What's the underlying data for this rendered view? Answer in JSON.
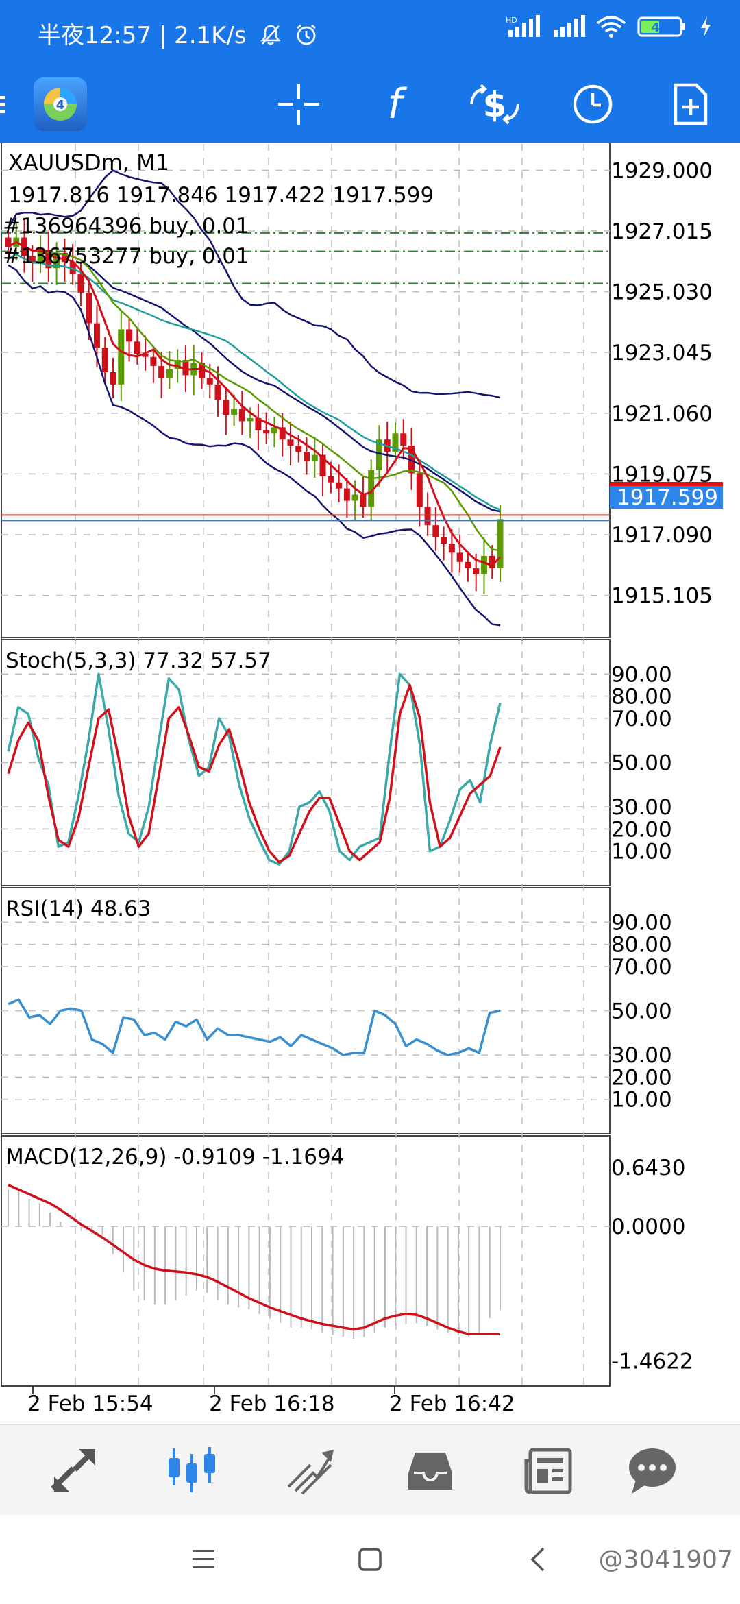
{
  "status": {
    "time": "半夜12:57",
    "speed": "2.1K/s",
    "battery": "41",
    "hd_label": "HD"
  },
  "toolbar": {
    "icons": [
      "menu-icon",
      "metatrader-logo-icon",
      "crosshair-icon",
      "indicators-icon",
      "trade-icon",
      "timeframe-icon",
      "templates-icon"
    ]
  },
  "chart": {
    "symbol": "XAUUSDm, M1",
    "ohlc": "1917.816 1917.846 1917.422 1917.599",
    "orders": [
      "#136964396 buy, 0.01",
      "#136753277 buy, 0.01"
    ],
    "current_price": "1917.599",
    "colors": {
      "bull": "#5c9b00",
      "bear": "#d0101a",
      "bollinger": "#141472",
      "ma_slow": "#1f9e9e",
      "ma_fast": "#5c9b00",
      "ma_red": "#d0101a",
      "bid_line": "#c0392b",
      "ask_line": "#3a78c2",
      "price_label_bg": "#2e86e8"
    }
  },
  "chart_data": [
    {
      "type": "candlestick",
      "title": "XAUUSDm, M1",
      "ylim": [
        1914.0,
        1929.5
      ],
      "y_ticks": [
        "1929.000",
        "1927.015",
        "1925.030",
        "1923.045",
        "1921.060",
        "1919.075",
        "1917.090",
        "1915.105"
      ],
      "x_ticks": [
        "2 Feb 15:54",
        "2 Feb 16:18",
        "2 Feb 16:42"
      ],
      "candles_close": [
        1926.5,
        1926.8,
        1926.2,
        1926.0,
        1926.4,
        1925.8,
        1926.3,
        1926.0,
        1925.6,
        1925.0,
        1924.0,
        1923.2,
        1922.4,
        1922.0,
        1923.8,
        1923.4,
        1923.0,
        1922.9,
        1922.6,
        1922.2,
        1922.5,
        1922.8,
        1922.3,
        1922.7,
        1922.2,
        1922.0,
        1921.5,
        1921.0,
        1921.2,
        1920.8,
        1920.9,
        1920.5,
        1920.4,
        1920.6,
        1920.2,
        1920.0,
        1919.8,
        1919.5,
        1919.7,
        1919.0,
        1918.8,
        1918.6,
        1918.2,
        1918.4,
        1918.0,
        1919.2,
        1920.2,
        1919.8,
        1920.4,
        1920.0,
        1919.1,
        1918.0,
        1917.4,
        1917.0,
        1916.8,
        1916.5,
        1916.2,
        1916.0,
        1915.8,
        1916.4,
        1916.0,
        1917.6
      ],
      "current": 1917.599,
      "series": [
        {
          "name": "",
          "values": []
        }
      ]
    },
    {
      "type": "line",
      "title": "Stoch(5,3,3) 77.32 57.57",
      "ylim": [
        0,
        100
      ],
      "y_ticks": [
        "90.00",
        "80.00",
        "70.00",
        "50.00",
        "30.00",
        "20.00",
        "10.00"
      ],
      "series": [
        {
          "name": "",
          "values": [
            55,
            75,
            72,
            52,
            40,
            12,
            14,
            35,
            60,
            90,
            65,
            35,
            18,
            14,
            30,
            60,
            88,
            83,
            60,
            44,
            48,
            70,
            62,
            40,
            25,
            15,
            6,
            4,
            10,
            30,
            32,
            37,
            28,
            10,
            6,
            12,
            14,
            16,
            55,
            90,
            85,
            58,
            10,
            12,
            24,
            38,
            42,
            32,
            58,
            77
          ]
        },
        {
          "name": "",
          "values": [
            45,
            60,
            68,
            60,
            35,
            15,
            12,
            25,
            48,
            70,
            74,
            52,
            26,
            12,
            18,
            44,
            70,
            75,
            62,
            48,
            46,
            58,
            65,
            50,
            32,
            20,
            10,
            5,
            8,
            18,
            28,
            34,
            34,
            22,
            10,
            6,
            10,
            14,
            34,
            72,
            85,
            70,
            32,
            12,
            16,
            26,
            36,
            40,
            44,
            57
          ]
        }
      ]
    },
    {
      "type": "line",
      "title": "RSI(14) 48.63",
      "ylim": [
        0,
        100
      ],
      "y_ticks": [
        "90.00",
        "80.00",
        "70.00",
        "50.00",
        "30.00",
        "20.00",
        "10.00"
      ],
      "series": [
        {
          "name": "",
          "values": [
            53,
            55,
            47,
            48,
            44,
            50,
            51,
            50,
            37,
            35,
            31,
            47,
            46,
            39,
            40,
            37,
            45,
            43,
            46,
            37,
            42,
            39,
            39,
            38,
            37,
            36,
            38,
            34,
            39,
            37,
            35,
            33,
            30,
            31,
            31,
            50,
            48,
            44,
            34,
            37,
            35,
            32,
            30,
            31,
            33,
            31,
            49,
            50
          ]
        }
      ]
    },
    {
      "type": "bar",
      "title": "MACD(12,26,9) -0.9109 -1.1694",
      "ylim": [
        -1.6,
        0.85
      ],
      "y_ticks": [
        "0.6430",
        "0.0000",
        "-1.4622"
      ],
      "series": [
        {
          "name": "",
          "values": [
            0.4,
            0.4,
            0.3,
            0.25,
            0.15,
            0.05,
            0.0,
            -0.05,
            -0.08,
            -0.1,
            -0.3,
            -0.5,
            -0.7,
            -0.8,
            -0.85,
            -0.85,
            -0.8,
            -0.75,
            -0.7,
            -0.72,
            -0.8,
            -0.85,
            -0.88,
            -0.9,
            -0.95,
            -1.0,
            -1.05,
            -1.1,
            -1.1,
            -1.12,
            -1.15,
            -1.18,
            -1.2,
            -1.22,
            -1.2,
            -1.15,
            -1.1,
            -1.08,
            -1.06,
            -1.05,
            -1.08,
            -1.12,
            -1.15,
            -1.18,
            -1.2,
            -1.15,
            -1.0,
            -0.91
          ]
        },
        {
          "name": "",
          "values": [
            0.45,
            0.4,
            0.35,
            0.3,
            0.25,
            0.18,
            0.1,
            0.02,
            -0.05,
            -0.12,
            -0.2,
            -0.28,
            -0.36,
            -0.42,
            -0.46,
            -0.48,
            -0.49,
            -0.5,
            -0.52,
            -0.55,
            -0.6,
            -0.66,
            -0.72,
            -0.78,
            -0.83,
            -0.88,
            -0.92,
            -0.96,
            -1.0,
            -1.03,
            -1.06,
            -1.08,
            -1.1,
            -1.12,
            -1.1,
            -1.05,
            -1.0,
            -0.97,
            -0.95,
            -0.96,
            -1.0,
            -1.05,
            -1.1,
            -1.14,
            -1.17,
            -1.17,
            -1.17,
            -1.17
          ]
        }
      ]
    }
  ],
  "bottom_nav": {
    "items": [
      "quotes-icon",
      "chart-icon",
      "trade-icon",
      "history-icon",
      "news-icon",
      "messages-icon"
    ]
  },
  "watermark": "@3041907"
}
